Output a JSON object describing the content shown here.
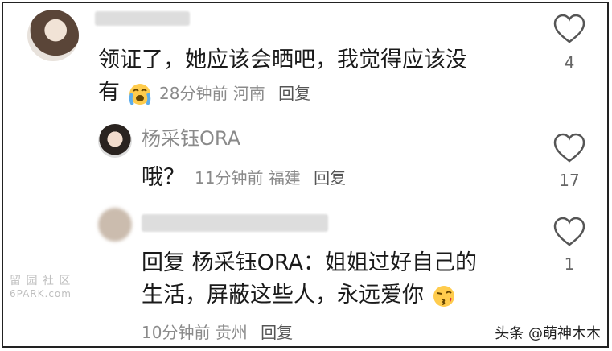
{
  "comment1": {
    "text_line1": "领证了，她应该会晒吧，我觉得应该没",
    "text_line2": "有",
    "time": "28分钟前",
    "location": "河南",
    "reply_label": "回复",
    "likes": "4"
  },
  "comment2": {
    "username": "杨采钰ORA",
    "text": "哦？",
    "time": "11分钟前",
    "location": "福建",
    "reply_label": "回复",
    "likes": "17"
  },
  "comment3": {
    "text_line1": "回复 杨采钰ORA：姐姐过好自己的",
    "text_line2": "生活，屏蔽这些人，永远爱你",
    "time": "10分钟前",
    "location": "贵州",
    "reply_label": "回复",
    "likes": "1"
  },
  "watermark": {
    "line1": "留 园 社 区",
    "line2": "6PARK.com"
  },
  "credit": "头条 @萌神木木",
  "icons": [
    "heart-outline-icon",
    "crying-emoji-icon",
    "kiss-emoji-icon"
  ]
}
